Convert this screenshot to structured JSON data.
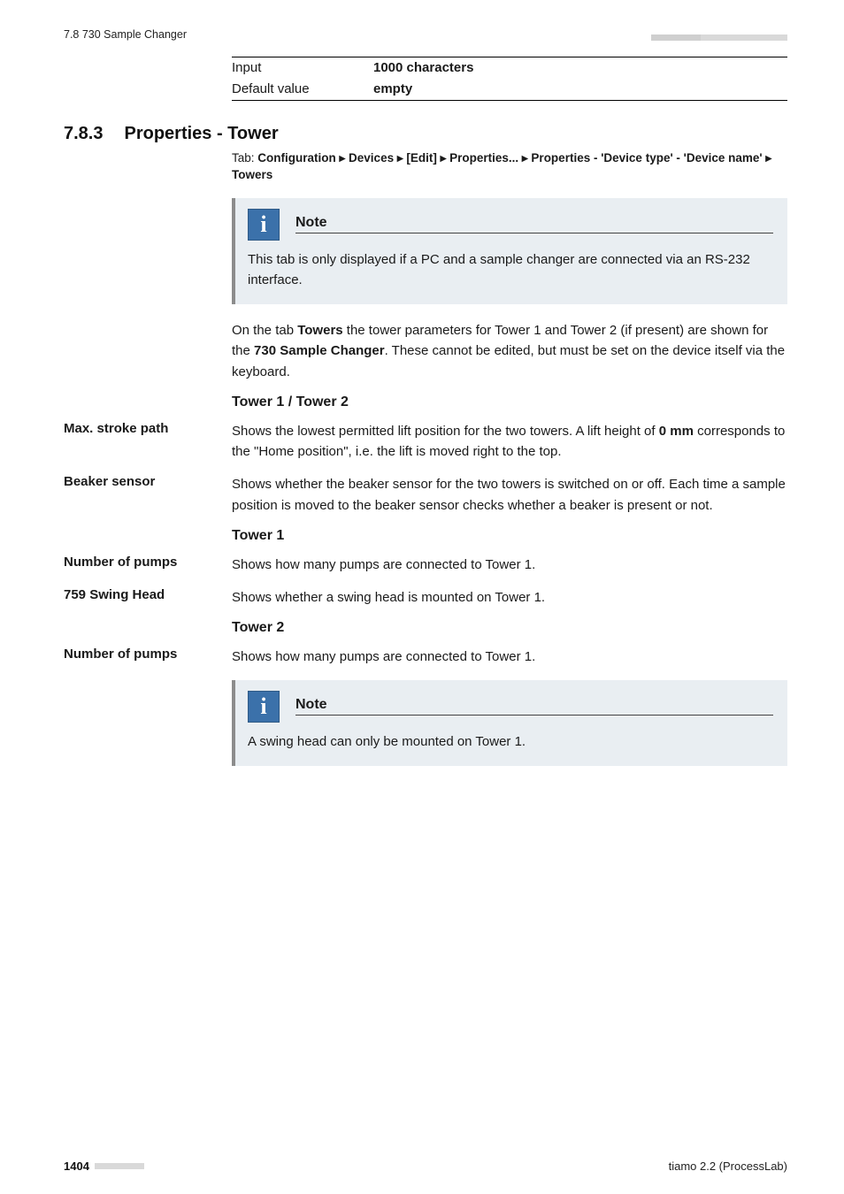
{
  "header": {
    "left": "7.8 730 Sample Changer"
  },
  "propTable": {
    "rows": [
      {
        "label": "Input",
        "value": "1000 characters"
      },
      {
        "label": "Default value",
        "value": "empty"
      }
    ]
  },
  "section": {
    "num": "7.8.3",
    "title": "Properties - Tower",
    "tabline_prefix": "Tab: ",
    "tabline_bold": "Configuration ▸ Devices ▸ [Edit] ▸ Properties... ▸ Properties - 'Device type' - 'Device name' ▸ Towers"
  },
  "note1": {
    "title": "Note",
    "body": "This tab is only displayed if a PC and a sample changer are connected via an RS-232 interface."
  },
  "para1_a": "On the tab ",
  "para1_b": "Towers",
  "para1_c": " the tower parameters for Tower 1 and Tower 2 (if present) are shown for the ",
  "para1_d": "730 Sample Changer",
  "para1_e": ". These cannot be edited, but must be set on the device itself via the keyboard.",
  "h_tower12": "Tower 1 / Tower 2",
  "def_maxstroke": {
    "term": "Max. stroke path",
    "desc_a": "Shows the lowest permitted lift position for the two towers. A lift height of ",
    "desc_b": "0 mm",
    "desc_c": " corresponds to the \"Home position\", i.e. the lift is moved right to the top."
  },
  "def_beaker": {
    "term": "Beaker sensor",
    "desc": "Shows whether the beaker sensor for the two towers is switched on or off. Each time a sample position is moved to the beaker sensor checks whether a beaker is present or not."
  },
  "h_tower1": "Tower 1",
  "def_numpumps1": {
    "term": "Number of pumps",
    "desc": "Shows how many pumps are connected to Tower 1."
  },
  "def_swing": {
    "term": "759 Swing Head",
    "desc": "Shows whether a swing head is mounted on Tower 1."
  },
  "h_tower2": "Tower 2",
  "def_numpumps2": {
    "term": "Number of pumps",
    "desc": "Shows how many pumps are connected to Tower 1."
  },
  "note2": {
    "title": "Note",
    "body": "A swing head can only be mounted on Tower 1."
  },
  "footer": {
    "page": "1404",
    "right": "tiamo 2.2 (ProcessLab)"
  }
}
